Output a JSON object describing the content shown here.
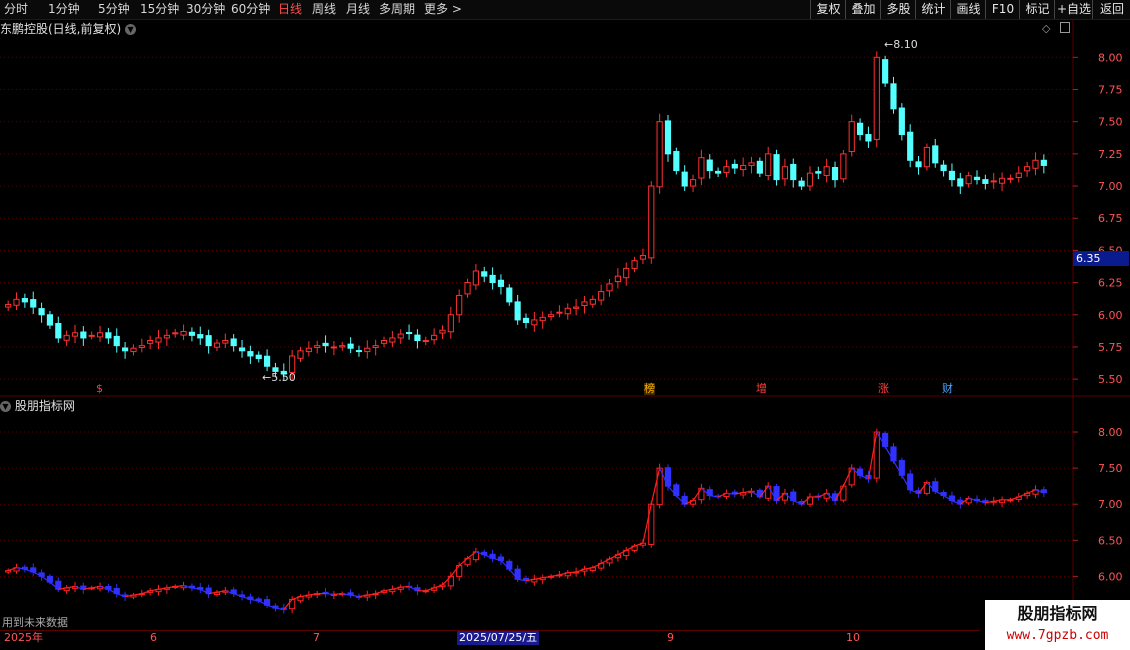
{
  "toolbar": {
    "periods": [
      "分时",
      "1分钟",
      "5分钟",
      "15分钟",
      "30分钟",
      "60分钟",
      "日线",
      "周线",
      "月线",
      "多周期",
      "更多 >"
    ],
    "active_period": "日线",
    "right_buttons": [
      "复权",
      "叠加",
      "多股",
      "统计",
      "画线",
      "F10",
      "标记",
      "+自选",
      "返回"
    ]
  },
  "main_chart": {
    "stock_title": "东鹏控股(日线,前复权)",
    "price_axis": [
      "8.00",
      "7.75",
      "7.50",
      "7.25",
      "7.00",
      "6.75",
      "6.50",
      "6.25",
      "6.00",
      "5.75",
      "5.50"
    ],
    "current_price": "6.35",
    "high_label": "8.10",
    "low_label": "5.50",
    "event_markers": [
      {
        "text": "$",
        "color": "#ff4040"
      },
      {
        "text": "榜",
        "color": "#ffb000"
      },
      {
        "text": "增",
        "color": "#ff4040"
      },
      {
        "text": "涨",
        "color": "#ff4040"
      },
      {
        "text": "财",
        "color": "#4da6ff"
      }
    ]
  },
  "sub_chart": {
    "title": "股朋指标网",
    "price_axis": [
      "8.00",
      "7.50",
      "7.00",
      "6.50",
      "6.00"
    ],
    "footer_note": "用到未来数据"
  },
  "date_axis": {
    "labels": [
      "2025年",
      "6",
      "7",
      "9",
      "10"
    ],
    "selected_date": "2025/07/25/五"
  },
  "watermark": {
    "title": "股朋指标网",
    "url": "www.7gpzb.com"
  },
  "colors": {
    "up": "#ff3030",
    "down": "#54ffff",
    "grid": "#5a0000",
    "wave_up": "#ff2020",
    "wave_down": "#3030ff"
  },
  "chart_data": {
    "type": "candlestick",
    "title": "东鹏控股(日线,前复权)",
    "ylim": [
      5.4,
      8.15
    ],
    "closes": [
      6.08,
      6.12,
      6.1,
      6.06,
      6.0,
      5.92,
      5.82,
      5.84,
      5.86,
      5.82,
      5.84,
      5.86,
      5.82,
      5.76,
      5.72,
      5.74,
      5.76,
      5.8,
      5.82,
      5.84,
      5.86,
      5.87,
      5.84,
      5.82,
      5.76,
      5.78,
      5.8,
      5.76,
      5.72,
      5.68,
      5.66,
      5.6,
      5.56,
      5.54,
      5.68,
      5.72,
      5.74,
      5.76,
      5.76,
      5.75,
      5.76,
      5.74,
      5.72,
      5.74,
      5.76,
      5.8,
      5.82,
      5.85,
      5.86,
      5.8,
      5.8,
      5.84,
      5.88,
      6.0,
      6.15,
      6.25,
      6.34,
      6.3,
      6.25,
      6.22,
      6.1,
      5.96,
      5.94,
      5.96,
      5.98,
      6.0,
      6.02,
      6.05,
      6.06,
      6.1,
      6.12,
      6.18,
      6.24,
      6.3,
      6.36,
      6.42,
      6.46,
      7.0,
      7.5,
      7.25,
      7.12,
      7.0,
      7.05,
      7.22,
      7.12,
      7.1,
      7.15,
      7.14,
      7.16,
      7.18,
      7.1,
      7.25,
      7.05,
      7.15,
      7.05,
      7.0,
      7.1,
      7.1,
      7.15,
      7.05,
      7.25,
      7.5,
      7.4,
      7.35,
      8.0,
      7.8,
      7.6,
      7.4,
      7.2,
      7.15,
      7.3,
      7.18,
      7.12,
      7.05,
      7.0,
      7.08,
      7.05,
      7.02,
      7.04,
      7.06,
      7.06,
      7.1,
      7.15,
      7.2,
      7.16
    ]
  }
}
